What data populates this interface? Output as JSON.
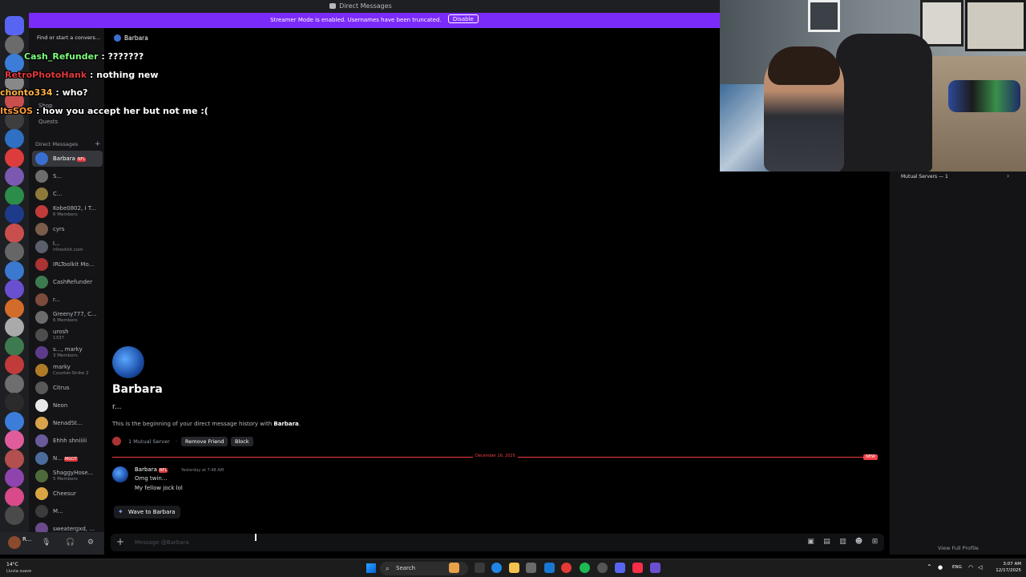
{
  "window": {
    "title": "Direct Messages"
  },
  "banner": {
    "text": "Streamer Mode is enabled. Usernames have been truncated.",
    "button": "Disable"
  },
  "search": {
    "label": "Find or start a convers..."
  },
  "nav": {
    "shop": "Shop",
    "quests": "Quests"
  },
  "dm_section": {
    "title": "Direct Messages",
    "add": "+"
  },
  "dms": [
    {
      "name": "Barbara",
      "tag": "NFL",
      "sub": "",
      "color": "#3a6fd1",
      "active": true
    },
    {
      "name": "S...",
      "tag": "",
      "sub": "",
      "color": "#6d6d6d"
    },
    {
      "name": "C...",
      "tag": "",
      "sub": "",
      "color": "#8d7a3b"
    },
    {
      "name": "Kobe0802, I T...",
      "tag": "",
      "sub": "6 Members",
      "color": "#c23b3b"
    },
    {
      "name": "cyrs",
      "tag": "",
      "sub": "",
      "color": "#7a5c4a"
    },
    {
      "name": "I...",
      "tag": "",
      "sub": "irlhostkit.com",
      "color": "#5a5f6b"
    },
    {
      "name": "IRLToolkit Mo...",
      "tag": "",
      "sub": "",
      "color": "#a33"
    },
    {
      "name": "CashRefunder",
      "tag": "",
      "sub": "",
      "color": "#3e7a4f"
    },
    {
      "name": "r...",
      "tag": "",
      "sub": "",
      "color": "#7b4b3b"
    },
    {
      "name": "Greeny777, C...",
      "tag": "",
      "sub": "6 Members",
      "color": "#6b6b6b"
    },
    {
      "name": "urosh",
      "tag": "",
      "sub": "1337",
      "color": "#4d4d4d"
    },
    {
      "name": "s..., marky",
      "tag": "",
      "sub": "3 Members",
      "color": "#5c3b8a"
    },
    {
      "name": "marky",
      "tag": "",
      "sub": "Counter-Strike 2",
      "color": "#b07b27"
    },
    {
      "name": "Citrus",
      "tag": "",
      "sub": "",
      "color": "#585858"
    },
    {
      "name": "Neon",
      "tag": "",
      "sub": "",
      "color": "#e8e8e8"
    },
    {
      "name": "NenadSt...",
      "tag": "",
      "sub": "",
      "color": "#d8a34b"
    },
    {
      "name": "Ehhh shniiiii",
      "tag": "",
      "sub": "",
      "color": "#6a5a9a"
    },
    {
      "name": "N...",
      "tag": "MGOT",
      "sub": "",
      "color": "#4b6b9b"
    },
    {
      "name": "ShaggyHose...",
      "tag": "",
      "sub": "5 Members",
      "color": "#4f6a3a"
    },
    {
      "name": "Cheesur",
      "tag": "",
      "sub": "",
      "color": "#d9a544"
    },
    {
      "name": "M...",
      "tag": "",
      "sub": "",
      "color": "#3b3b3b"
    },
    {
      "name": "sweatergxd, ...",
      "tag": "",
      "sub": "",
      "color": "#6a4a8a"
    }
  ],
  "user_panel": {
    "name": "R..."
  },
  "chat": {
    "header_name": "Barbara",
    "profile_name": "Barbara",
    "profile_tag": "r...",
    "beginning_prefix": "This is the beginning of your direct message history with ",
    "beginning_name": "Barbara",
    "beginning_suffix": ".",
    "mutual": "1 Mutual Server",
    "dot": "·",
    "remove_friend": "Remove Friend",
    "block": "Block",
    "divider_date": "December 16, 2025",
    "divider_new": "NEW",
    "message": {
      "author": "Barbara",
      "tag": "NFL",
      "time": "Yesterday at 7:48 AM",
      "lines": [
        "Omg twin...",
        "My fellow jock lol"
      ]
    },
    "wave": "Wave to Barbara",
    "composer_placeholder": "Message @Barbara"
  },
  "profile_panel": {
    "mutual_servers": "Mutual Servers — 1",
    "view_full": "View Full Profile"
  },
  "overlay_chat": [
    {
      "user": "Cash_Refunder",
      "sep": " : ",
      "text": "???????",
      "color": "#7dff7d"
    },
    {
      "user": "RetroPhotoHank",
      "sep": " : ",
      "text": "nothing new",
      "color": "#e0383b"
    },
    {
      "user": "chonto334",
      "sep": " : ",
      "text": "who?",
      "color": "#ffb347"
    },
    {
      "user": "ItsSOS",
      "sep": " : ",
      "text": "how you accept her but not me :(",
      "color": "#ff9a3c"
    }
  ],
  "taskbar": {
    "temp": "14°C",
    "weather": "Lluvia suave",
    "search": "Search",
    "lang": "ENG",
    "time": "3:07 AM",
    "date": "12/17/2025"
  }
}
